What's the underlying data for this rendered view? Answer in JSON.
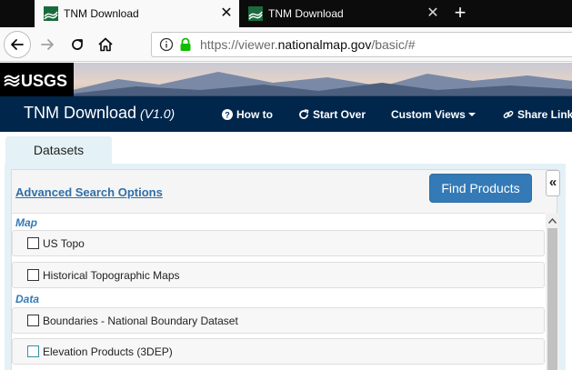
{
  "browser": {
    "tabs": [
      {
        "title": "TNM Download",
        "active": true
      },
      {
        "title": "TNM Download",
        "active": false
      }
    ],
    "new_tab_glyph": "+",
    "close_glyph": "✕",
    "url_prefix": "https://viewer.",
    "url_host": "nationalmap.gov",
    "url_suffix": "/basic/#",
    "icons": {
      "back": "back-arrow-icon",
      "forward": "forward-arrow-icon",
      "reload": "reload-icon",
      "home": "home-icon",
      "info": "info-icon",
      "lock": "lock-icon"
    }
  },
  "banner": {
    "logo_text": "USGS"
  },
  "app": {
    "title": "TNM Download",
    "version": "(V1.0)",
    "menu": {
      "how_to": "How to",
      "start_over": "Start Over",
      "custom_views": "Custom Views",
      "share_link": "Share Link"
    }
  },
  "panel": {
    "tab_label": "Datasets",
    "advanced_search": "Advanced Search Options",
    "find_products": "Find Products",
    "collapse_glyph": "«",
    "sections": [
      {
        "header": "Map",
        "items": [
          "US Topo",
          "Historical Topographic Maps"
        ]
      },
      {
        "header": "Data",
        "items": [
          "Boundaries - National Boundary Dataset",
          "Elevation Products (3DEP)"
        ]
      }
    ]
  },
  "colors": {
    "app_header": "#00264c",
    "primary_button": "#337ab7",
    "panel_background": "#e4f1f6",
    "section_header": "#337ab7",
    "link": "#2f6fa8",
    "secure_lock": "#12bc00"
  }
}
